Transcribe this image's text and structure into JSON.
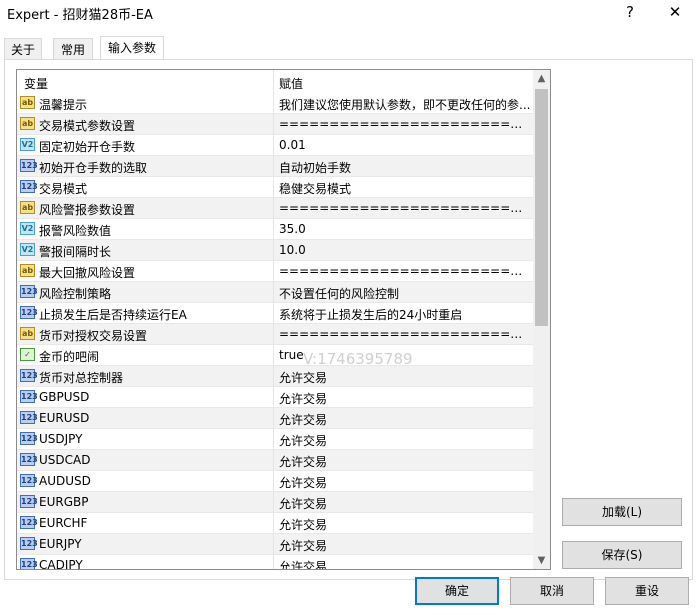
{
  "window": {
    "title": "Expert - 招财猫28币-EA",
    "help_glyph": "?",
    "close_glyph": "✕"
  },
  "tabs": [
    {
      "label": "关于"
    },
    {
      "label": "常用"
    },
    {
      "label": "输入参数"
    }
  ],
  "grid": {
    "col_variable": "变量",
    "col_value": "赋值",
    "rows": [
      {
        "icon": "ab",
        "name": "温馨提示",
        "value": "我们建议您使用默认参数，即不更改任何的参..."
      },
      {
        "icon": "ab",
        "name": "交易模式参数设置",
        "value": "============================..."
      },
      {
        "icon": "v2",
        "name": "固定初始开仓手数",
        "value": "0.01"
      },
      {
        "icon": "123",
        "name": "初始开仓手数的选取",
        "value": "自动初始手数"
      },
      {
        "icon": "123",
        "name": "交易模式",
        "value": "稳健交易模式"
      },
      {
        "icon": "ab",
        "name": "风险警报参数设置",
        "value": "============================..."
      },
      {
        "icon": "v2",
        "name": "报警风险数值",
        "value": "35.0"
      },
      {
        "icon": "v2",
        "name": "警报间隔时长",
        "value": "10.0"
      },
      {
        "icon": "ab",
        "name": "最大回撤风险设置",
        "value": "============================..."
      },
      {
        "icon": "123",
        "name": "风险控制策略",
        "value": "不设置任何的风险控制"
      },
      {
        "icon": "123",
        "name": "止损发生后是否持续运行EA",
        "value": "系统将于止损发生后的24小时重启"
      },
      {
        "icon": "ab",
        "name": "货币对授权交易设置",
        "value": "============================..."
      },
      {
        "icon": "bool",
        "name": "金币的吧闹",
        "value": "true"
      },
      {
        "icon": "123",
        "name": "货币对总控制器",
        "value": "允许交易"
      },
      {
        "icon": "123",
        "name": "GBPUSD",
        "value": "允许交易"
      },
      {
        "icon": "123",
        "name": "EURUSD",
        "value": "允许交易"
      },
      {
        "icon": "123",
        "name": "USDJPY",
        "value": "允许交易"
      },
      {
        "icon": "123",
        "name": "USDCAD",
        "value": "允许交易"
      },
      {
        "icon": "123",
        "name": "AUDUSD",
        "value": "允许交易"
      },
      {
        "icon": "123",
        "name": "EURGBP",
        "value": "允许交易"
      },
      {
        "icon": "123",
        "name": "EURCHF",
        "value": "允许交易"
      },
      {
        "icon": "123",
        "name": "EURJPY",
        "value": "允许交易"
      },
      {
        "icon": "123",
        "name": "CADJPY",
        "value": "允许交易"
      }
    ],
    "scroll_up_glyph": "▲",
    "scroll_down_glyph": "▼"
  },
  "watermark": "V:1746395789",
  "buttons": {
    "load": "加载(L)",
    "save": "保存(S)",
    "ok": "确定",
    "cancel": "取消",
    "reset": "重设"
  }
}
